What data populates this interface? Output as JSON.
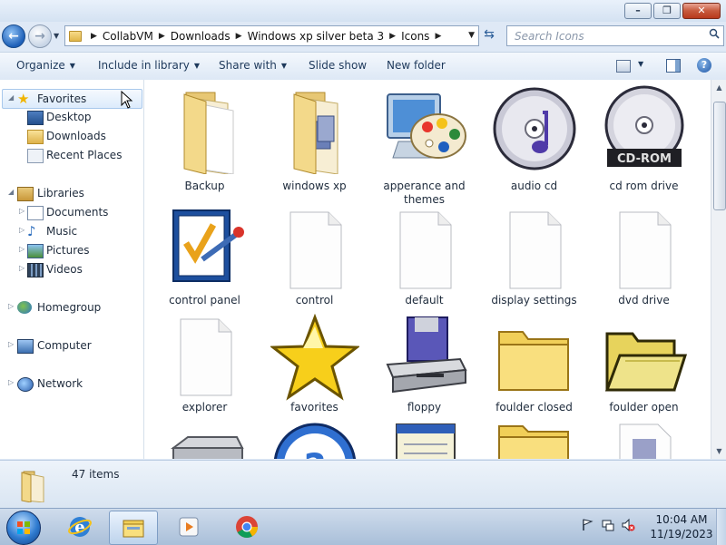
{
  "window": {
    "caption_buttons": {
      "minimize": "minimize",
      "maximize": "maximize",
      "close": "close"
    }
  },
  "address_bar": {
    "breadcrumbs": [
      "CollabVM",
      "Downloads",
      "Windows xp silver beta 3",
      "Icons"
    ]
  },
  "search": {
    "placeholder": "Search Icons"
  },
  "command_bar": {
    "organize": "Organize",
    "include_in_library": "Include in library",
    "share_with": "Share with",
    "slide_show": "Slide show",
    "new_folder": "New folder"
  },
  "nav_pane": {
    "favorites": "Favorites",
    "desktop": "Desktop",
    "downloads": "Downloads",
    "recent_places": "Recent Places",
    "libraries": "Libraries",
    "documents": "Documents",
    "music": "Music",
    "pictures": "Pictures",
    "videos": "Videos",
    "homegroup": "Homegroup",
    "computer": "Computer",
    "network": "Network"
  },
  "files": [
    {
      "name": "Backup",
      "icon": "folder-icon"
    },
    {
      "name": "windows xp",
      "icon": "folder-icon"
    },
    {
      "name": "apperance and themes",
      "icon": "palette-monitor-icon"
    },
    {
      "name": "audio cd",
      "icon": "audio-cd-icon"
    },
    {
      "name": "cd rom drive",
      "icon": "cd-rom-icon"
    },
    {
      "name": "control panel",
      "icon": "control-panel-icon"
    },
    {
      "name": "control",
      "icon": "blank-file-icon"
    },
    {
      "name": "default",
      "icon": "blank-file-icon"
    },
    {
      "name": "display settings",
      "icon": "blank-file-icon"
    },
    {
      "name": "dvd drive",
      "icon": "blank-file-icon"
    },
    {
      "name": "explorer",
      "icon": "blank-file-icon"
    },
    {
      "name": "favorites",
      "icon": "star-icon"
    },
    {
      "name": "floppy",
      "icon": "floppy-icon"
    },
    {
      "name": "foulder closed",
      "icon": "folder-closed-icon"
    },
    {
      "name": "foulder open",
      "icon": "folder-open-icon"
    }
  ],
  "details_pane": {
    "count": "47 items"
  },
  "taskbar": {
    "time": "10:04 AM",
    "date": "11/19/2023"
  }
}
